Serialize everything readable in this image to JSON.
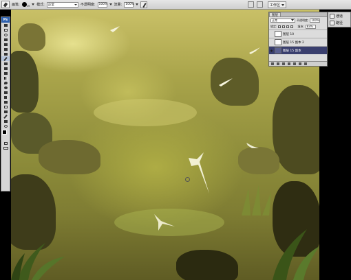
{
  "options_bar": {
    "brush_label": "画笔:",
    "brush_size": "19",
    "mode_label": "模式:",
    "mode_value": "正常",
    "opacity_label": "不透明度:",
    "opacity_value": "100%",
    "flow_label": "流量:",
    "flow_value": "100%",
    "workspace_label": "工作区"
  },
  "tools": {
    "app_badge": "Ps",
    "items": [
      "move",
      "marquee",
      "lasso",
      "magic-wand",
      "crop",
      "slice",
      "healing",
      "brush",
      "stamp",
      "history-brush",
      "eraser",
      "gradient",
      "blur",
      "dodge",
      "pen",
      "type",
      "path-select",
      "shape",
      "notes",
      "eyedropper",
      "hand",
      "zoom"
    ],
    "selected": "brush"
  },
  "layers_panel": {
    "tabs": [
      "图层"
    ],
    "blend_mode": "正常",
    "opacity_label": "不透明度:",
    "opacity_value": "100%",
    "lock_label": "锁定:",
    "fill_label": "填充:",
    "fill_value": "83%",
    "layers": [
      {
        "name": "图层 10",
        "visible": false,
        "active": false
      },
      {
        "name": "图层 15 副本 2",
        "visible": false,
        "active": false
      },
      {
        "name": "图层 15 副本",
        "visible": true,
        "active": true
      }
    ]
  },
  "dock": {
    "items": [
      {
        "icon": "navigator-icon",
        "label": "通道"
      },
      {
        "icon": "paths-icon",
        "label": "路径"
      }
    ]
  },
  "colors": {
    "foreground": "#000000",
    "background": "#ffffff",
    "active_layer": "#3a3f6e"
  }
}
